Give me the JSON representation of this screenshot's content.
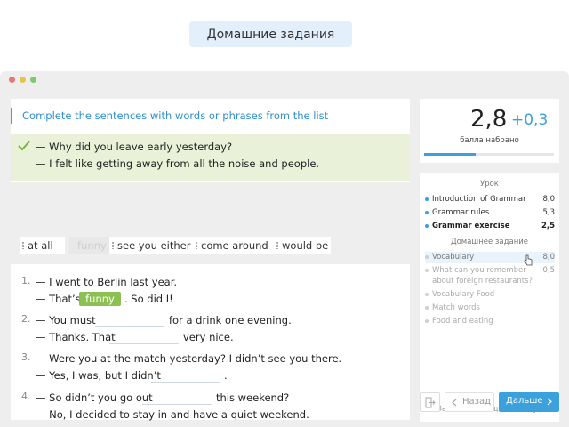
{
  "header_badge": "Домашние задания",
  "task": {
    "title": "Complete the sentences with words or phrases from the list",
    "example": [
      "— Why did you leave early yesterday?",
      "— I felt like getting away from all the noise and people."
    ]
  },
  "word_bank": [
    {
      "text": "at all",
      "used": false
    },
    {
      "text": "funny",
      "used": true
    },
    {
      "text": "see you either",
      "used": false
    },
    {
      "text": "come around",
      "used": false
    },
    {
      "text": "would be",
      "used": false
    }
  ],
  "exercises": [
    {
      "number": "1.",
      "line1": "— I went to Berlin last year.",
      "line2_before": "— That’s",
      "line2_fill": "funny",
      "line2_after": ". So did I!"
    },
    {
      "number": "2.",
      "line1_before": "— You must",
      "line1_after": "for a drink one evening.",
      "line2_before": "— Thanks. That",
      "line2_after": "very nice."
    },
    {
      "number": "3.",
      "line1": "— Were you at the match yesterday? I didn’t see you there.",
      "line2_before": "— Yes, I was, but I didn’t",
      "line2_after": "."
    },
    {
      "number": "4.",
      "line1_before": "— So didn’t you go out",
      "line1_after": "this weekend?",
      "line2": "— No, I decided to stay in and have a quiet weekend."
    }
  ],
  "score": {
    "value": "2,8",
    "delta": "+0,3",
    "label": "балла набрано",
    "progress": 0.4
  },
  "menu": {
    "lesson_title": "Урок",
    "lesson_items": [
      {
        "label": "Introduction of Grammar",
        "value": "8,0"
      },
      {
        "label": "Grammar rules",
        "value": "5,3"
      },
      {
        "label": "Grammar exercise",
        "value": "2,5"
      }
    ],
    "homework_title": "Домашнее задание",
    "homework_items": [
      {
        "label": "Vocabulary",
        "value": "8,0"
      },
      {
        "label": "What can you remember",
        "label2": "about foreign restaurants?",
        "value": "0,5"
      },
      {
        "label": "Vocabulary Food",
        "value": ""
      },
      {
        "label": "Match words",
        "value": ""
      },
      {
        "label": "Food and eating",
        "value": ""
      }
    ],
    "footer": "Заниматься еще 15 минут"
  },
  "nav": {
    "back": "Назад",
    "next": "Дальше"
  },
  "colors": {
    "accent": "#3aa1dc",
    "correct_bg": "#e9f2d9",
    "fill_chip": "#8cc152"
  }
}
